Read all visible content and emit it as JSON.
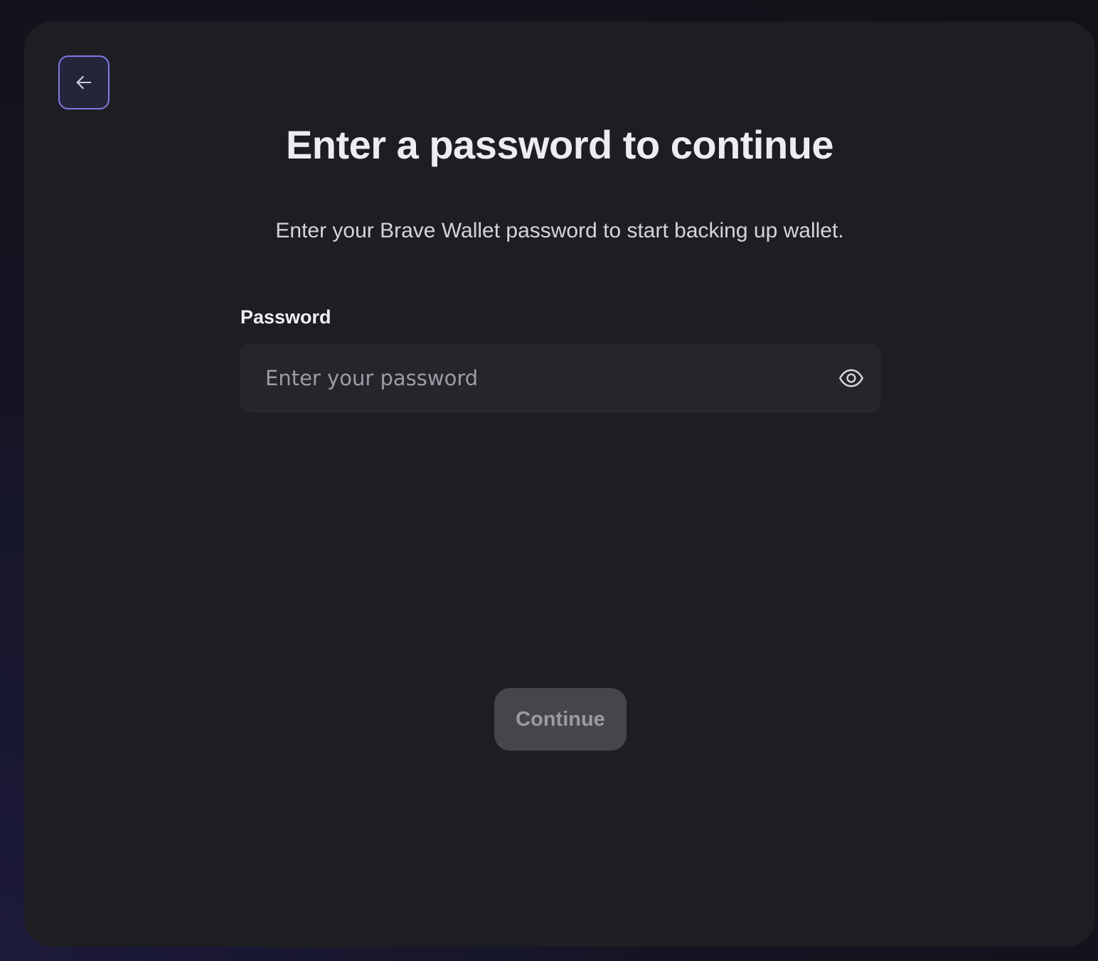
{
  "page": {
    "title": "Enter a password to continue",
    "subtitle": "Enter your Brave Wallet password to start backing up wallet."
  },
  "form": {
    "password_label": "Password",
    "password_value": "",
    "password_placeholder": "Enter your password",
    "show_password_icon": "eye-icon",
    "continue_label": "Continue",
    "continue_disabled": true
  },
  "nav": {
    "back_icon": "arrow-left-icon"
  },
  "colors": {
    "accent_border": "#7b7ae8",
    "card_background": "#1d1d22",
    "input_background": "#25252b",
    "button_disabled_background": "#45454c",
    "button_disabled_text": "#9a9aa2"
  }
}
